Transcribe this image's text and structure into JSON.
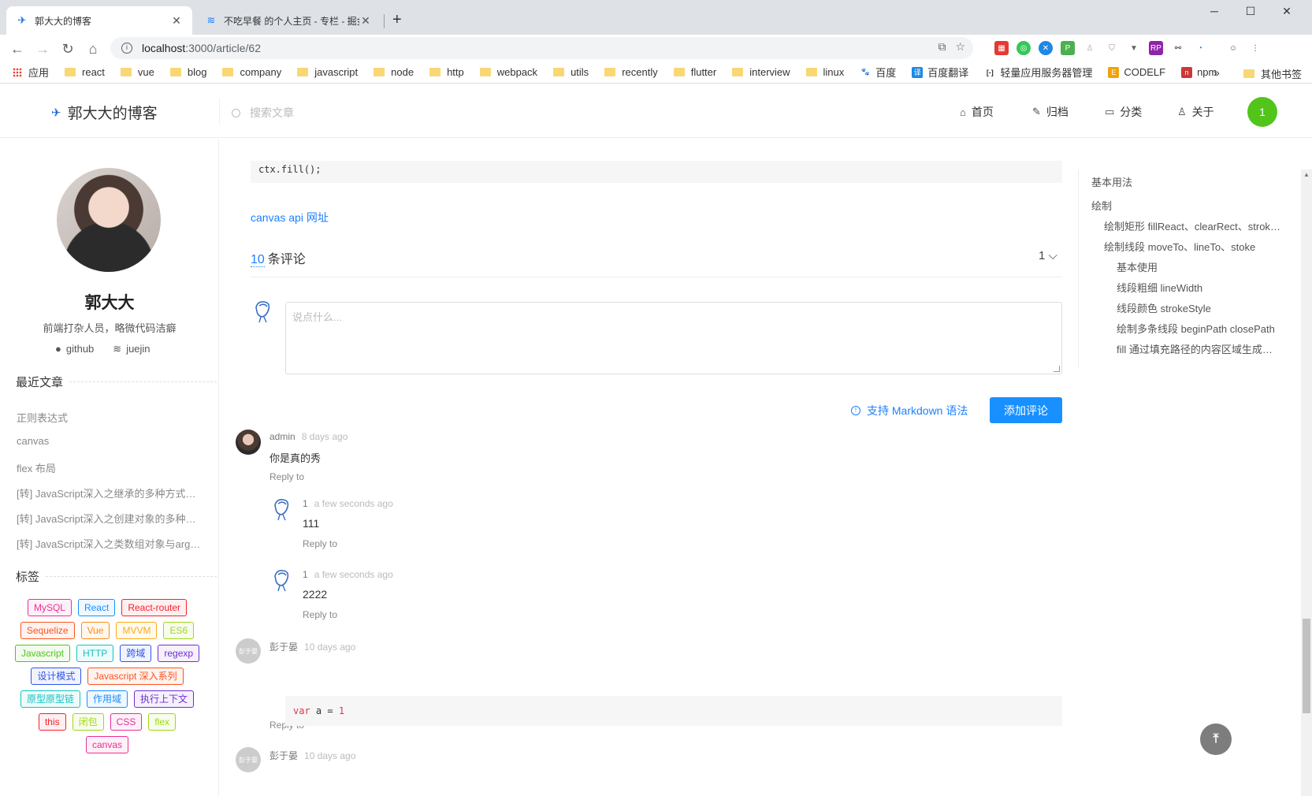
{
  "browser": {
    "tabs": [
      {
        "title": "郭大大的博客",
        "active": true
      },
      {
        "title": "不吃早餐 的个人主页 - 专栏 - 掘金",
        "active": false
      }
    ],
    "url_host": "localhost",
    "url_path": ":3000/article/62",
    "bookmarks": [
      "应用",
      "react",
      "vue",
      "blog",
      "company",
      "javascript",
      "node",
      "http",
      "webpack",
      "utils",
      "recently",
      "flutter",
      "interview",
      "linux",
      "百度",
      "百度翻译",
      "轻量应用服务器管理",
      "CODELF",
      "npm"
    ],
    "bookmarks_more": "»",
    "other_bookmarks": "其他书签"
  },
  "header": {
    "logo": "郭大大的博客",
    "search_placeholder": "搜索文章",
    "nav": [
      "首页",
      "归档",
      "分类",
      "关于"
    ],
    "user_initial": "1"
  },
  "profile": {
    "name": "郭大大",
    "desc": "前端打杂人员，略微代码洁癖",
    "github": "github",
    "juejin": "juejin"
  },
  "recent": {
    "title": "最近文章",
    "items": [
      "正则表达式",
      "canvas",
      "flex 布局",
      "[转] JavaScript深入之继承的多种方式和优缺点",
      "[转] JavaScript深入之创建对象的多种方式以及优缺点",
      "[转] JavaScript深入之类数组对象与arguments"
    ]
  },
  "tags": {
    "title": "标签",
    "items": [
      {
        "label": "MySQL",
        "color": "#eb2f96"
      },
      {
        "label": "React",
        "color": "#1890ff"
      },
      {
        "label": "React-router",
        "color": "#f5222d"
      },
      {
        "label": "Sequelize",
        "color": "#fa541c"
      },
      {
        "label": "Vue",
        "color": "#fa8c16"
      },
      {
        "label": "MVVM",
        "color": "#faad14"
      },
      {
        "label": "ES6",
        "color": "#a0d911"
      },
      {
        "label": "Javascript",
        "color": "#52c41a"
      },
      {
        "label": "HTTP",
        "color": "#13c2c2"
      },
      {
        "label": "跨域",
        "color": "#2f54eb"
      },
      {
        "label": "regexp",
        "color": "#722ed1"
      },
      {
        "label": "设计模式",
        "color": "#2f54eb"
      },
      {
        "label": "Javascript 深入系列",
        "color": "#fa541c"
      },
      {
        "label": "原型原型链",
        "color": "#13c2c2"
      },
      {
        "label": "作用域",
        "color": "#1890ff"
      },
      {
        "label": "执行上下文",
        "color": "#722ed1"
      },
      {
        "label": "this",
        "color": "#f5222d"
      },
      {
        "label": "闭包",
        "color": "#a0d911"
      },
      {
        "label": "CSS",
        "color": "#eb2f96"
      },
      {
        "label": "flex",
        "color": "#a0d911"
      },
      {
        "label": "canvas",
        "color": "#eb2f96"
      }
    ]
  },
  "article": {
    "code_line": "ctx.fill();",
    "api_link": "canvas api 网址",
    "comment_count": "10",
    "comment_label": "条评论",
    "sort_label": "1 ⌵",
    "editor_placeholder": "说点什么...",
    "md_tip": "支持 Markdown 语法",
    "add_button": "添加评论"
  },
  "comments": [
    {
      "author": "admin",
      "time": "8 days ago",
      "text": "你是真的秀",
      "reply": "Reply to"
    },
    {
      "author": "1",
      "time": "a few seconds ago",
      "text": "111",
      "reply": "Reply to"
    },
    {
      "author": "1",
      "time": "a few seconds ago",
      "text": "2222",
      "reply": "Reply to"
    },
    {
      "author": "彭于晏",
      "time": "10 days ago",
      "code_kw": "var",
      "code_rest": " a = ",
      "code_val": "1",
      "reply": "Reply to",
      "avatar_text": "彭于晏"
    },
    {
      "author": "彭于晏",
      "time": "10 days ago",
      "avatar_text": "彭于晏"
    }
  ],
  "toc": [
    {
      "label": "基本用法",
      "level": 1
    },
    {
      "label": "绘制",
      "level": 1
    },
    {
      "label": "绘制矩形 fillReact、clearRect、strokeRect",
      "level": 2
    },
    {
      "label": "绘制线段 moveTo、lineTo、stoke",
      "level": 2
    },
    {
      "label": "基本使用",
      "level": 3
    },
    {
      "label": "线段粗细 lineWidth",
      "level": 3
    },
    {
      "label": "线段颜色 strokeStyle",
      "level": 3
    },
    {
      "label": "绘制多条线段 beginPath closePath",
      "level": 3
    },
    {
      "label": "fill 通过填充路径的内容区域生成实心的图形",
      "level": 3
    }
  ]
}
